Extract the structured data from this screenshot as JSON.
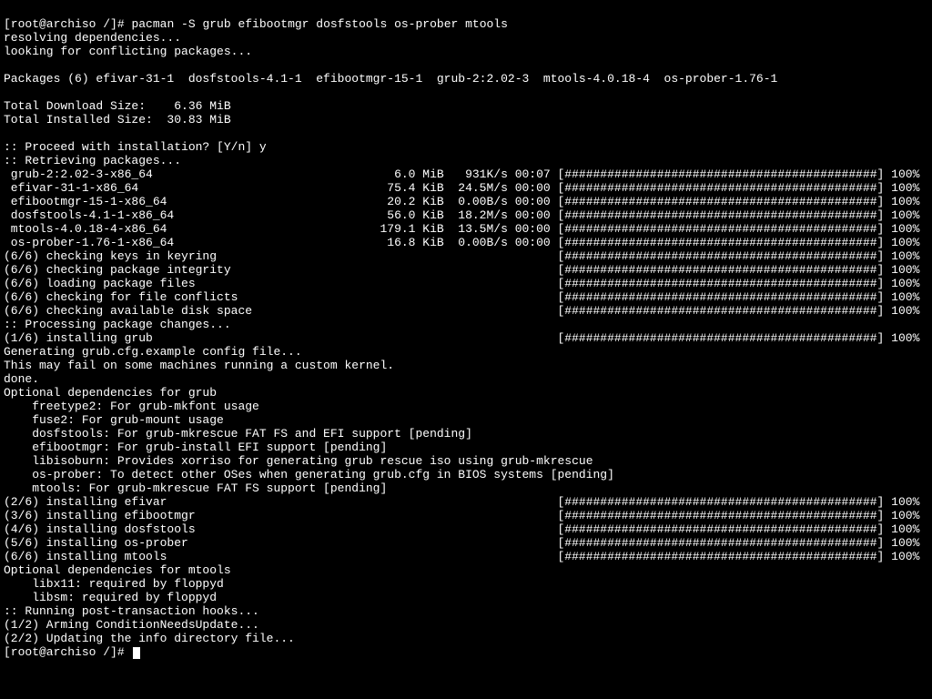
{
  "prompt1": "[root@archiso /]# ",
  "command": "pacman -S grub efibootmgr dosfstools os-prober mtools",
  "resolving": "resolving dependencies...",
  "looking": "looking for conflicting packages...",
  "packages_header": "Packages (6) efivar-31-1  dosfstools-4.1-1  efibootmgr-15-1  grub-2:2.02-3  mtools-4.0.18-4  os-prober-1.76-1",
  "total_dl": "Total Download Size:    6.36 MiB",
  "total_inst": "Total Installed Size:  30.83 MiB",
  "proceed": ":: Proceed with installation? [Y/n] y",
  "retrieving": ":: Retrieving packages...",
  "dl_lines": [
    " grub-2:2.02-3-x86_64                                  6.0 MiB   931K/s 00:07 [############################################] 100%",
    " efivar-31-1-x86_64                                   75.4 KiB  24.5M/s 00:00 [############################################] 100%",
    " efibootmgr-15-1-x86_64                               20.2 KiB  0.00B/s 00:00 [############################################] 100%",
    " dosfstools-4.1-1-x86_64                              56.0 KiB  18.2M/s 00:00 [############################################] 100%",
    " mtools-4.0.18-4-x86_64                              179.1 KiB  13.5M/s 00:00 [############################################] 100%",
    " os-prober-1.76-1-x86_64                              16.8 KiB  0.00B/s 00:00 [############################################] 100%"
  ],
  "check_lines": [
    "(6/6) checking keys in keyring                                                [############################################] 100%",
    "(6/6) checking package integrity                                              [############################################] 100%",
    "(6/6) loading package files                                                   [############################################] 100%",
    "(6/6) checking for file conflicts                                             [############################################] 100%",
    "(6/6) checking available disk space                                           [############################################] 100%"
  ],
  "processing": ":: Processing package changes...",
  "install1": "(1/6) installing grub                                                         [############################################] 100%",
  "gen_cfg": "Generating grub.cfg.example config file...",
  "may_fail": "This may fail on some machines running a custom kernel.",
  "done": "done.",
  "opt_grub_hdr": "Optional dependencies for grub",
  "opt_grub": [
    "    freetype2: For grub-mkfont usage",
    "    fuse2: For grub-mount usage",
    "    dosfstools: For grub-mkrescue FAT FS and EFI support [pending]",
    "    efibootmgr: For grub-install EFI support [pending]",
    "    libisoburn: Provides xorriso for generating grub rescue iso using grub-mkrescue",
    "    os-prober: To detect other OSes when generating grub.cfg in BIOS systems [pending]",
    "    mtools: For grub-mkrescue FAT FS support [pending]"
  ],
  "install_rest": [
    "(2/6) installing efivar                                                       [############################################] 100%",
    "(3/6) installing efibootmgr                                                   [############################################] 100%",
    "(4/6) installing dosfstools                                                   [############################################] 100%",
    "(5/6) installing os-prober                                                    [############################################] 100%",
    "(6/6) installing mtools                                                       [############################################] 100%"
  ],
  "opt_mtools_hdr": "Optional dependencies for mtools",
  "opt_mtools": [
    "    libx11: required by floppyd",
    "    libsm: required by floppyd"
  ],
  "hooks": ":: Running post-transaction hooks...",
  "hook1": "(1/2) Arming ConditionNeedsUpdate...",
  "hook2": "(2/2) Updating the info directory file...",
  "prompt2": "[root@archiso /]# "
}
